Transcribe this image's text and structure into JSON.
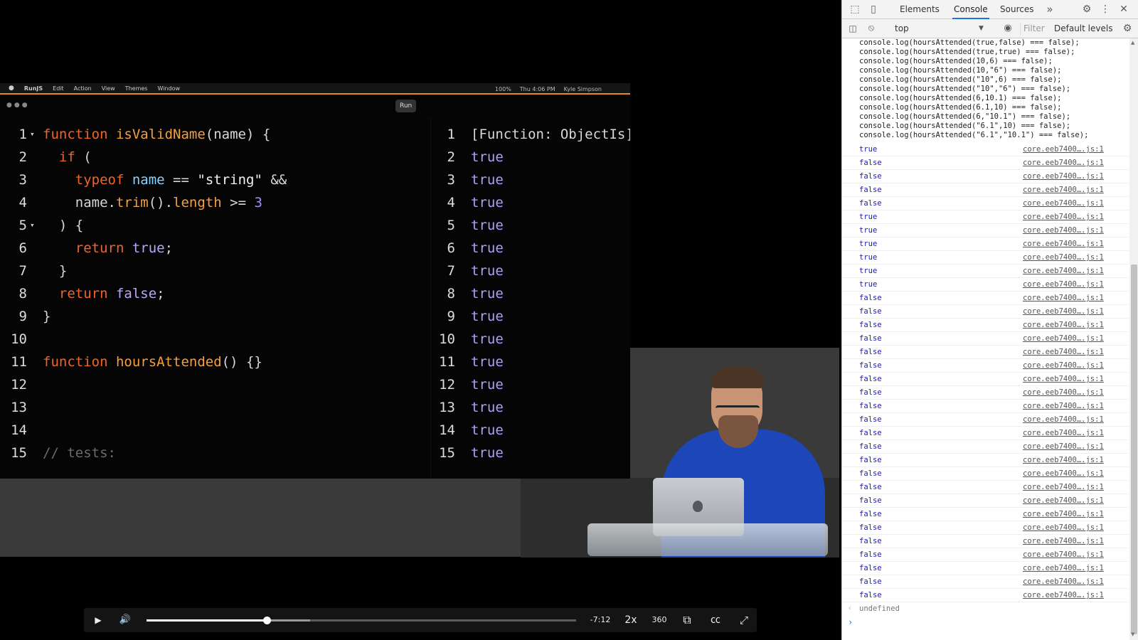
{
  "video": {
    "mac": {
      "menu": [
        "",
        "RunJS",
        "Edit",
        "Action",
        "View",
        "Themes",
        "Window"
      ],
      "menu_right": [
        "100%",
        "Thu 4:06 PM",
        "Kyle Simpson"
      ],
      "traffic": "●●●",
      "run_label": "Run"
    },
    "code_lines": [
      {
        "num": "1",
        "fold": "▾",
        "tokens": [
          [
            "k",
            "function "
          ],
          [
            "f",
            "isValidName"
          ],
          [
            "p",
            "(name) {"
          ]
        ]
      },
      {
        "num": "2",
        "fold": "",
        "tokens": [
          [
            "p",
            "  "
          ],
          [
            "k",
            "if"
          ],
          [
            "p",
            " ("
          ]
        ]
      },
      {
        "num": "3",
        "fold": "",
        "tokens": [
          [
            "p",
            "    "
          ],
          [
            "k",
            "typeof "
          ],
          [
            "m",
            "name"
          ],
          [
            "p",
            " == "
          ],
          [
            "s",
            "\"string\""
          ],
          [
            "p",
            " &&"
          ]
        ]
      },
      {
        "num": "4",
        "fold": "",
        "tokens": [
          [
            "p",
            "    name."
          ],
          [
            "f",
            "trim"
          ],
          [
            "p",
            "()."
          ],
          [
            "f",
            "length"
          ],
          [
            "p",
            " >= "
          ],
          [
            "n",
            "3"
          ]
        ]
      },
      {
        "num": "5",
        "fold": "▾",
        "tokens": [
          [
            "p",
            "  ) {"
          ]
        ]
      },
      {
        "num": "6",
        "fold": "",
        "tokens": [
          [
            "p",
            "    "
          ],
          [
            "k",
            "return "
          ],
          [
            "b",
            "true"
          ],
          [
            "p",
            ";"
          ]
        ]
      },
      {
        "num": "7",
        "fold": "",
        "tokens": [
          [
            "p",
            "  }"
          ]
        ]
      },
      {
        "num": "8",
        "fold": "",
        "tokens": [
          [
            "p",
            "  "
          ],
          [
            "k",
            "return "
          ],
          [
            "b",
            "false"
          ],
          [
            "p",
            ";"
          ]
        ]
      },
      {
        "num": "9",
        "fold": "",
        "tokens": [
          [
            "p",
            "}"
          ]
        ]
      },
      {
        "num": "10",
        "fold": "",
        "tokens": []
      },
      {
        "num": "11",
        "fold": "",
        "tokens": [
          [
            "k",
            "function "
          ],
          [
            "f",
            "hoursAttended"
          ],
          [
            "p",
            "() {}"
          ]
        ]
      },
      {
        "num": "12",
        "fold": "",
        "tokens": []
      },
      {
        "num": "13",
        "fold": "",
        "tokens": []
      },
      {
        "num": "14",
        "fold": "",
        "tokens": []
      },
      {
        "num": "15",
        "fold": "",
        "tokens": [
          [
            "c",
            "// tests:"
          ]
        ]
      }
    ],
    "output_lines": [
      {
        "num": "1",
        "val": "[Function: ObjectIs]",
        "fn": true
      },
      {
        "num": "2",
        "val": "true"
      },
      {
        "num": "3",
        "val": "true"
      },
      {
        "num": "4",
        "val": "true"
      },
      {
        "num": "5",
        "val": "true"
      },
      {
        "num": "6",
        "val": "true"
      },
      {
        "num": "7",
        "val": "true"
      },
      {
        "num": "8",
        "val": "true"
      },
      {
        "num": "9",
        "val": "true"
      },
      {
        "num": "10",
        "val": "true"
      },
      {
        "num": "11",
        "val": "true"
      },
      {
        "num": "12",
        "val": "true"
      },
      {
        "num": "13",
        "val": "true"
      },
      {
        "num": "14",
        "val": "true"
      },
      {
        "num": "15",
        "val": "true"
      }
    ],
    "controls": {
      "play_icon": "▶",
      "volume_icon": "🔊",
      "time_remaining": "-7:12",
      "speed": "2x",
      "quality": "360",
      "pip_icon": "⧉",
      "cc_icon": "㏄",
      "fullscreen_icon": "⤢",
      "progress_fraction": 0.28,
      "buffered_fraction": 0.38
    }
  },
  "devtools": {
    "tabs": [
      "Elements",
      "Console",
      "Sources"
    ],
    "active_tab": "Console",
    "more_tabs": "»",
    "context": "top",
    "filter_placeholder": "Filter",
    "levels": "Default levels",
    "commands": [
      "console.log(hoursAttended(true,false) === false);",
      "console.log(hoursAttended(true,true) === false);",
      "console.log(hoursAttended(10,6) === false);",
      "console.log(hoursAttended(10,\"6\") === false);",
      "console.log(hoursAttended(\"10\",6) === false);",
      "console.log(hoursAttended(\"10\",\"6\") === false);",
      "console.log(hoursAttended(6,10.1) === false);",
      "console.log(hoursAttended(6.1,10) === false);",
      "console.log(hoursAttended(6,\"10.1\") === false);",
      "console.log(hoursAttended(\"6.1\",10) === false);",
      "console.log(hoursAttended(\"6.1\",\"10.1\") === false);"
    ],
    "source": "core.eeb7400….js:1",
    "logs": [
      "true",
      "false",
      "false",
      "false",
      "false",
      "true",
      "true",
      "true",
      "true",
      "true",
      "true",
      "false",
      "false",
      "false",
      "false",
      "false",
      "false",
      "false",
      "false",
      "false",
      "false",
      "false",
      "false",
      "false",
      "false",
      "false",
      "false",
      "false",
      "false",
      "false",
      "false",
      "false",
      "false",
      "false"
    ],
    "return_value": "undefined",
    "return_arrow": "‹",
    "prompt_arrow": "›"
  }
}
